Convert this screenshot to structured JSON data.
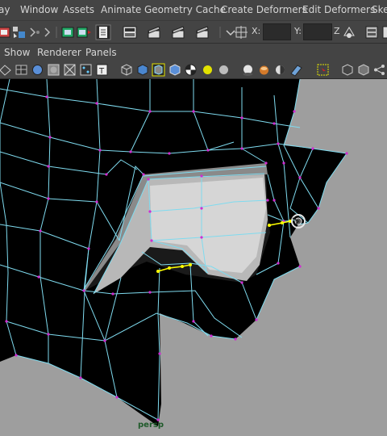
{
  "menubar": {
    "items": [
      "ay",
      "Window",
      "Assets",
      "Animate",
      "Geometry Cache",
      "Create Deformers",
      "Edit Deformers",
      "Skel"
    ]
  },
  "shelf": {
    "x_label": "X:",
    "y_label": "Y:",
    "z_label": "Z"
  },
  "panel_menus": [
    "Show",
    "Renderer",
    "Panels"
  ],
  "viewport": {
    "camera_label": "persp"
  },
  "colors": {
    "wire": "#7fdbef",
    "vertex": "#d12bd1",
    "selected": "#ffff00",
    "mesh": "#000000",
    "background": "#9e9e9e"
  }
}
